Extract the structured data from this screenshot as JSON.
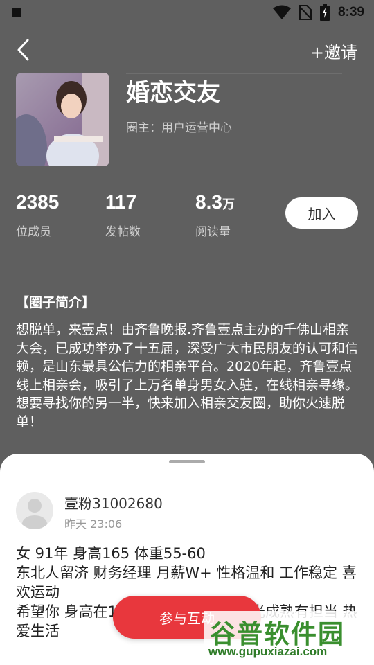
{
  "status_bar": {
    "time": "8:39"
  },
  "header": {
    "invite_label": "+邀请"
  },
  "group": {
    "title": "婚恋交友",
    "owner": "圈主：用户运营中心",
    "join_label": "加入"
  },
  "stats": [
    {
      "value": "2385",
      "unit": "",
      "label": "位成员"
    },
    {
      "value": "117",
      "unit": "",
      "label": "发帖数"
    },
    {
      "value": "8.3",
      "unit": "万",
      "label": "阅读量"
    }
  ],
  "intro": {
    "heading": "【圈子简介】",
    "text": "想脱单，来壹点！由齐鲁晚报.齐鲁壹点主办的千佛山相亲大会，已成功举办了十五届，深受广大市民朋友的认可和信赖，是山东最具公信力的相亲平台。2020年起，齐鲁壹点线上相亲会，吸引了上万名单身男女入驻，在线相亲寻缘。想要寻找你的另一半，快来加入相亲交友圈，助你火速脱单！"
  },
  "post": {
    "username": "壹粉31002680",
    "time": "昨天 23:06",
    "content": "女 91年 身高165 体重55-60\n东北人留济 财务经理 月薪W+ 性格温和 工作稳定 喜欢运动\n希望你 身高在175以上 35岁以下 阳光成熟有担当 热爱生活"
  },
  "cta_label": "参与互动",
  "watermark": {
    "main": "谷普软件园",
    "url": "www.gupuxiazai.com"
  }
}
